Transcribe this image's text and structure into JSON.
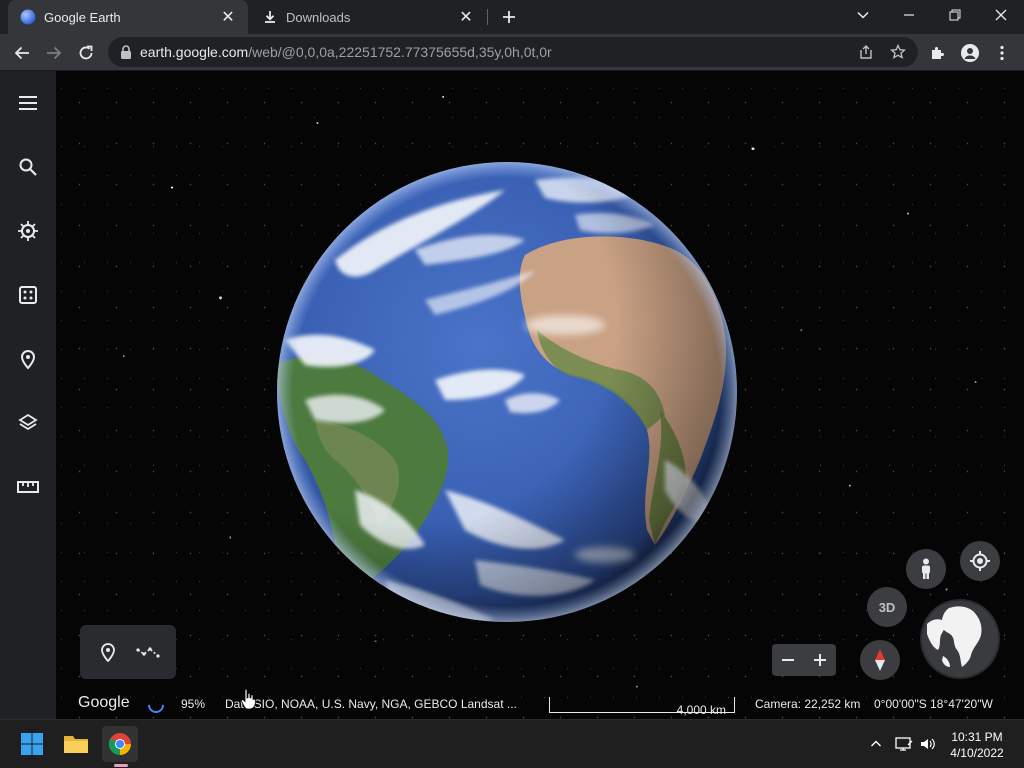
{
  "browser": {
    "tabs": [
      {
        "title": "Google Earth",
        "active": true
      },
      {
        "title": "Downloads",
        "active": false
      }
    ],
    "url_host": "earth.google.com",
    "url_path": "/web/@0,0,0a,22251752.77375655d,35y,0h,0t,0r"
  },
  "rail": {
    "items": [
      "menu-icon",
      "search-icon",
      "voyager-icon",
      "feeling-lucky-icon",
      "projects-icon",
      "map-style-icon",
      "measure-icon"
    ]
  },
  "status": {
    "brand": "Google",
    "loading_percent": "95%",
    "attribution": "Data SIO, NOAA, U.S. Navy, NGA, GEBCO  Landsat ...",
    "scale": "4,000 km",
    "camera": "Camera: 22,252 km",
    "coordinates": "0°00'00\"S 18°47'20\"W"
  },
  "controls": {
    "label_3d": "3D"
  },
  "taskbar": {
    "time": "10:31 PM",
    "date": "4/10/2022"
  },
  "colors": {
    "accent": "#4285f4",
    "ocean": "#3f64b8",
    "land": "#c9a184",
    "chrome_tab": "#35363a",
    "chrome_frame": "#202124"
  }
}
